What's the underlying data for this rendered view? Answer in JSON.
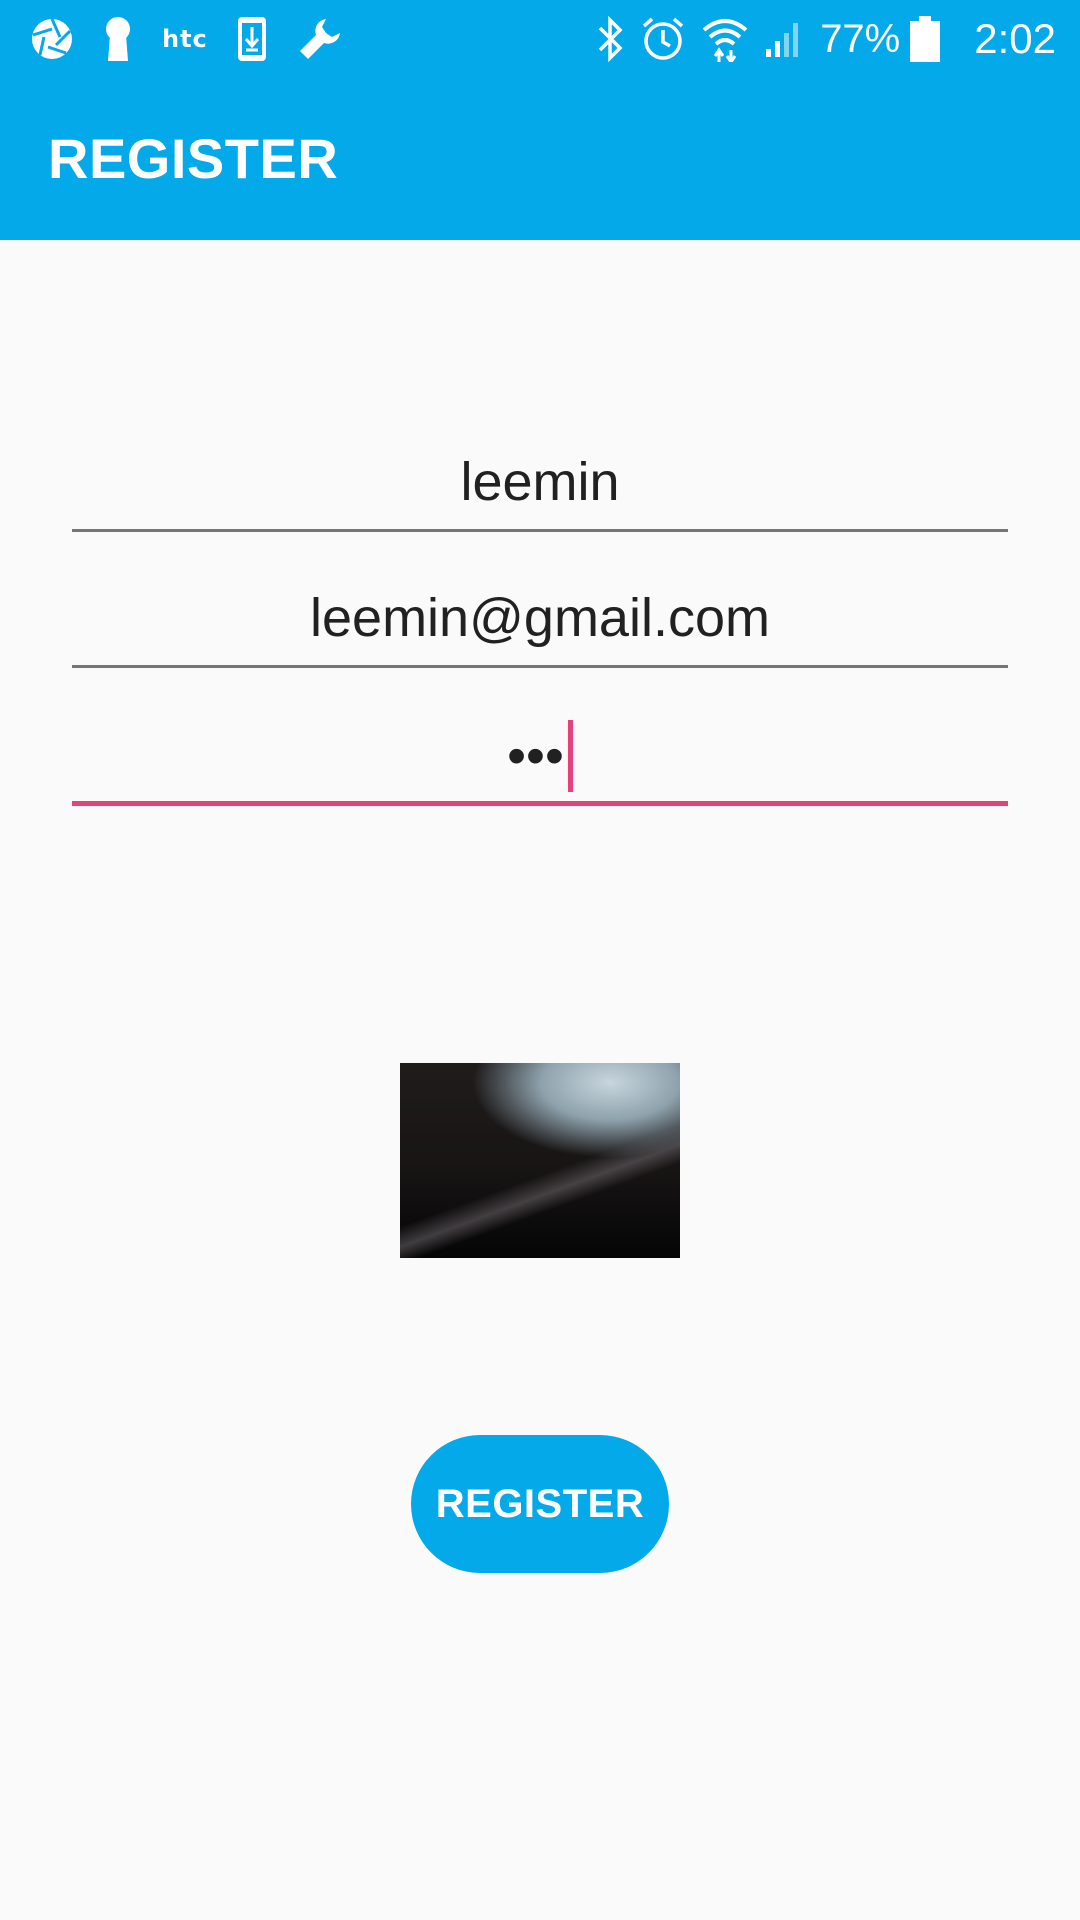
{
  "status_bar": {
    "carrier": "htc",
    "battery_percent": "77%",
    "time": "2:02",
    "left_icons": [
      "aperture-icon",
      "keyhole-icon",
      "htc-logo",
      "phone-download-icon",
      "wrench-icon"
    ],
    "right_icons": [
      "bluetooth-icon",
      "alarm-icon",
      "wifi-icon",
      "signal-icon",
      "battery-icon"
    ]
  },
  "app_bar": {
    "title": "REGISTER"
  },
  "form": {
    "username": {
      "value": "leemin"
    },
    "email": {
      "value": "leemin@gmail.com"
    },
    "password": {
      "value": "•••"
    }
  },
  "image_preview": {
    "icon": "photo-preview"
  },
  "register_button": {
    "label": "REGISTER"
  },
  "colors": {
    "primary": "#03a9e8",
    "accent": "#e8407a",
    "background": "#fafafa",
    "text": "#212121"
  }
}
